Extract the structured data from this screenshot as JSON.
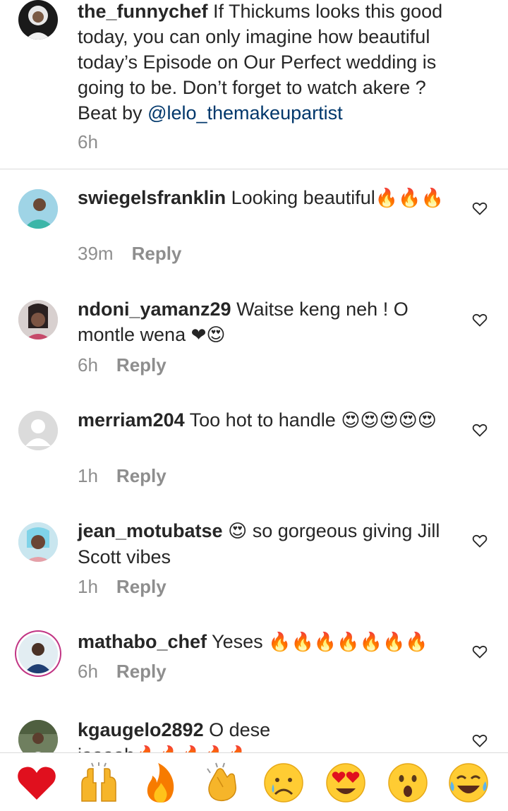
{
  "caption": {
    "username": "the_funnychef",
    "text_before_mention": " If Thickums looks this good today, you can only imagine how beautiful today’s Episode on Our Perfect wedding is going to be. Don’t forget to watch akere ? Beat by ",
    "mention": "@lelo_themakeupartist",
    "time": "6h"
  },
  "comments": [
    {
      "username": "swiegelsfranklin",
      "text": " Looking beautiful",
      "emoji": "🔥🔥🔥",
      "time": "39m",
      "reply": "Reply"
    },
    {
      "username": "ndoni_yamanz29",
      "text": " Waitse keng neh ! O montle wena ",
      "emoji": "❤😍",
      "time": "6h",
      "reply": "Reply"
    },
    {
      "username": "merriam204",
      "text": " Too hot to handle ",
      "emoji": "😍😍😍😍😍",
      "time": "1h",
      "reply": "Reply"
    },
    {
      "username": "jean_motubatse",
      "emoji_inline": "😍",
      "text": " so gorgeous giving Jill Scott vibes",
      "time": "1h",
      "reply": "Reply"
    },
    {
      "username": "mathabo_chef",
      "text": " Yeses ",
      "emoji": "🔥🔥🔥🔥🔥🔥🔥",
      "time": "6h",
      "reply": "Reply"
    },
    {
      "username": "kgaugelo2892",
      "text": " O dese",
      "second_line": "iaaaab",
      "emoji": "🔥🔥🔥🔥🔥"
    }
  ],
  "reaction_tray": [
    "heart",
    "raising-hands",
    "fire",
    "clapping-hands",
    "sad-face",
    "heart-eyes",
    "surprised-face",
    "tears-of-joy"
  ],
  "colors": {
    "username": "#262626",
    "mention": "#00376b",
    "meta": "#8e8e8e",
    "divider": "#dbdbdb",
    "heart": "#ed4956",
    "fire": "#f77b00"
  }
}
